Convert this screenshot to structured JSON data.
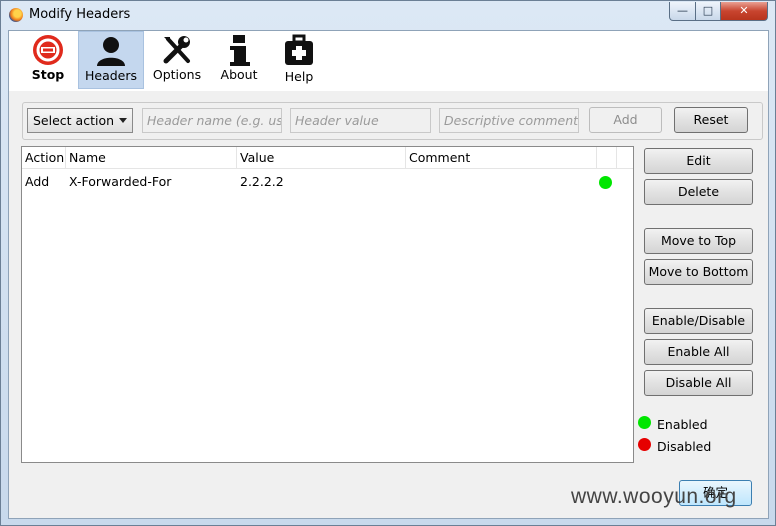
{
  "window": {
    "title": "Modify Headers",
    "controls": {
      "minimize": "—",
      "maximize": "□",
      "close": "✕"
    }
  },
  "toolbar": {
    "items": [
      {
        "label": "Stop",
        "icon": "stop-icon"
      },
      {
        "label": "Headers",
        "icon": "headers-icon",
        "active": true
      },
      {
        "label": "Options",
        "icon": "options-icon"
      },
      {
        "label": "About",
        "icon": "about-icon"
      },
      {
        "label": "Help",
        "icon": "help-icon"
      }
    ]
  },
  "form": {
    "action_select": "Select action",
    "header_name_placeholder": "Header name (e.g. use",
    "header_value_placeholder": "Header value",
    "comment_placeholder": "Descriptive comment",
    "add_label": "Add",
    "reset_label": "Reset"
  },
  "table": {
    "columns": [
      "Action",
      "Name",
      "Value",
      "Comment"
    ],
    "rows": [
      {
        "action": "Add",
        "name": "X-Forwarded-For",
        "value": "2.2.2.2",
        "comment": "",
        "enabled": true
      }
    ]
  },
  "side_buttons": {
    "edit": "Edit",
    "delete": "Delete",
    "move_top": "Move to Top",
    "move_bottom": "Move to Bottom",
    "enable_disable": "Enable/Disable",
    "enable_all": "Enable All",
    "disable_all": "Disable All"
  },
  "legend": {
    "enabled": "Enabled",
    "disabled": "Disabled"
  },
  "colors": {
    "enabled": "#00e600",
    "disabled": "#e60000",
    "active_tab": "#c4d7ee"
  },
  "ok_button": "确定",
  "watermark": "www.wooyun.org"
}
